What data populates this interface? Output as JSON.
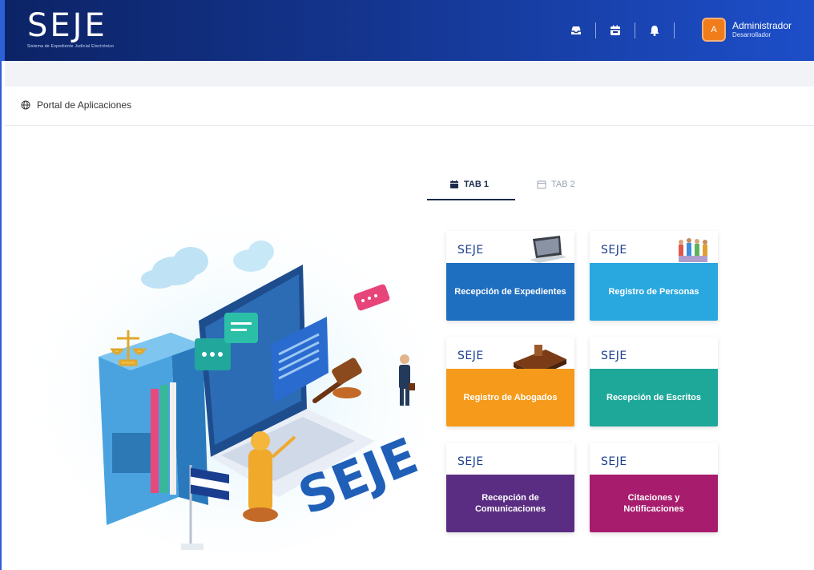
{
  "header": {
    "logo": "SEJE",
    "logo_subtitle": "Sistema de Expediente Judicial Electrónico",
    "icons": [
      "inbox-icon",
      "calendar-icon",
      "bell-icon"
    ],
    "user": {
      "avatar_letter": "A",
      "name": "Administrador",
      "role": "Desarrollador"
    }
  },
  "breadcrumb": {
    "icon": "globe-icon",
    "label": "Portal de Aplicaciones"
  },
  "tabs": [
    {
      "label": "TAB 1",
      "active": true
    },
    {
      "label": "TAB 2",
      "active": false
    }
  ],
  "illustration": {
    "brand_text": "SEJE"
  },
  "cards": [
    {
      "logo": "SEJE",
      "title": "Recepción de Expedientes",
      "color": "#1f6fc0"
    },
    {
      "logo": "SEJE",
      "title": "Registro de Personas",
      "color": "#29a8e0"
    },
    {
      "logo": "SEJE",
      "title": "Registro de Abogados",
      "color": "#f59a1b"
    },
    {
      "logo": "SEJE",
      "title": "Recepción de Escritos",
      "color": "#1ea899"
    },
    {
      "logo": "SEJE",
      "title": "Recepción de Comunicaciones",
      "color": "#5a2d82"
    },
    {
      "logo": "SEJE",
      "title": "Citaciones y Notificaciones",
      "color": "#a81c6e"
    }
  ],
  "colors": {
    "header_start": "#0c2366",
    "header_end": "#1d4ec9",
    "avatar": "#f07d1a"
  }
}
